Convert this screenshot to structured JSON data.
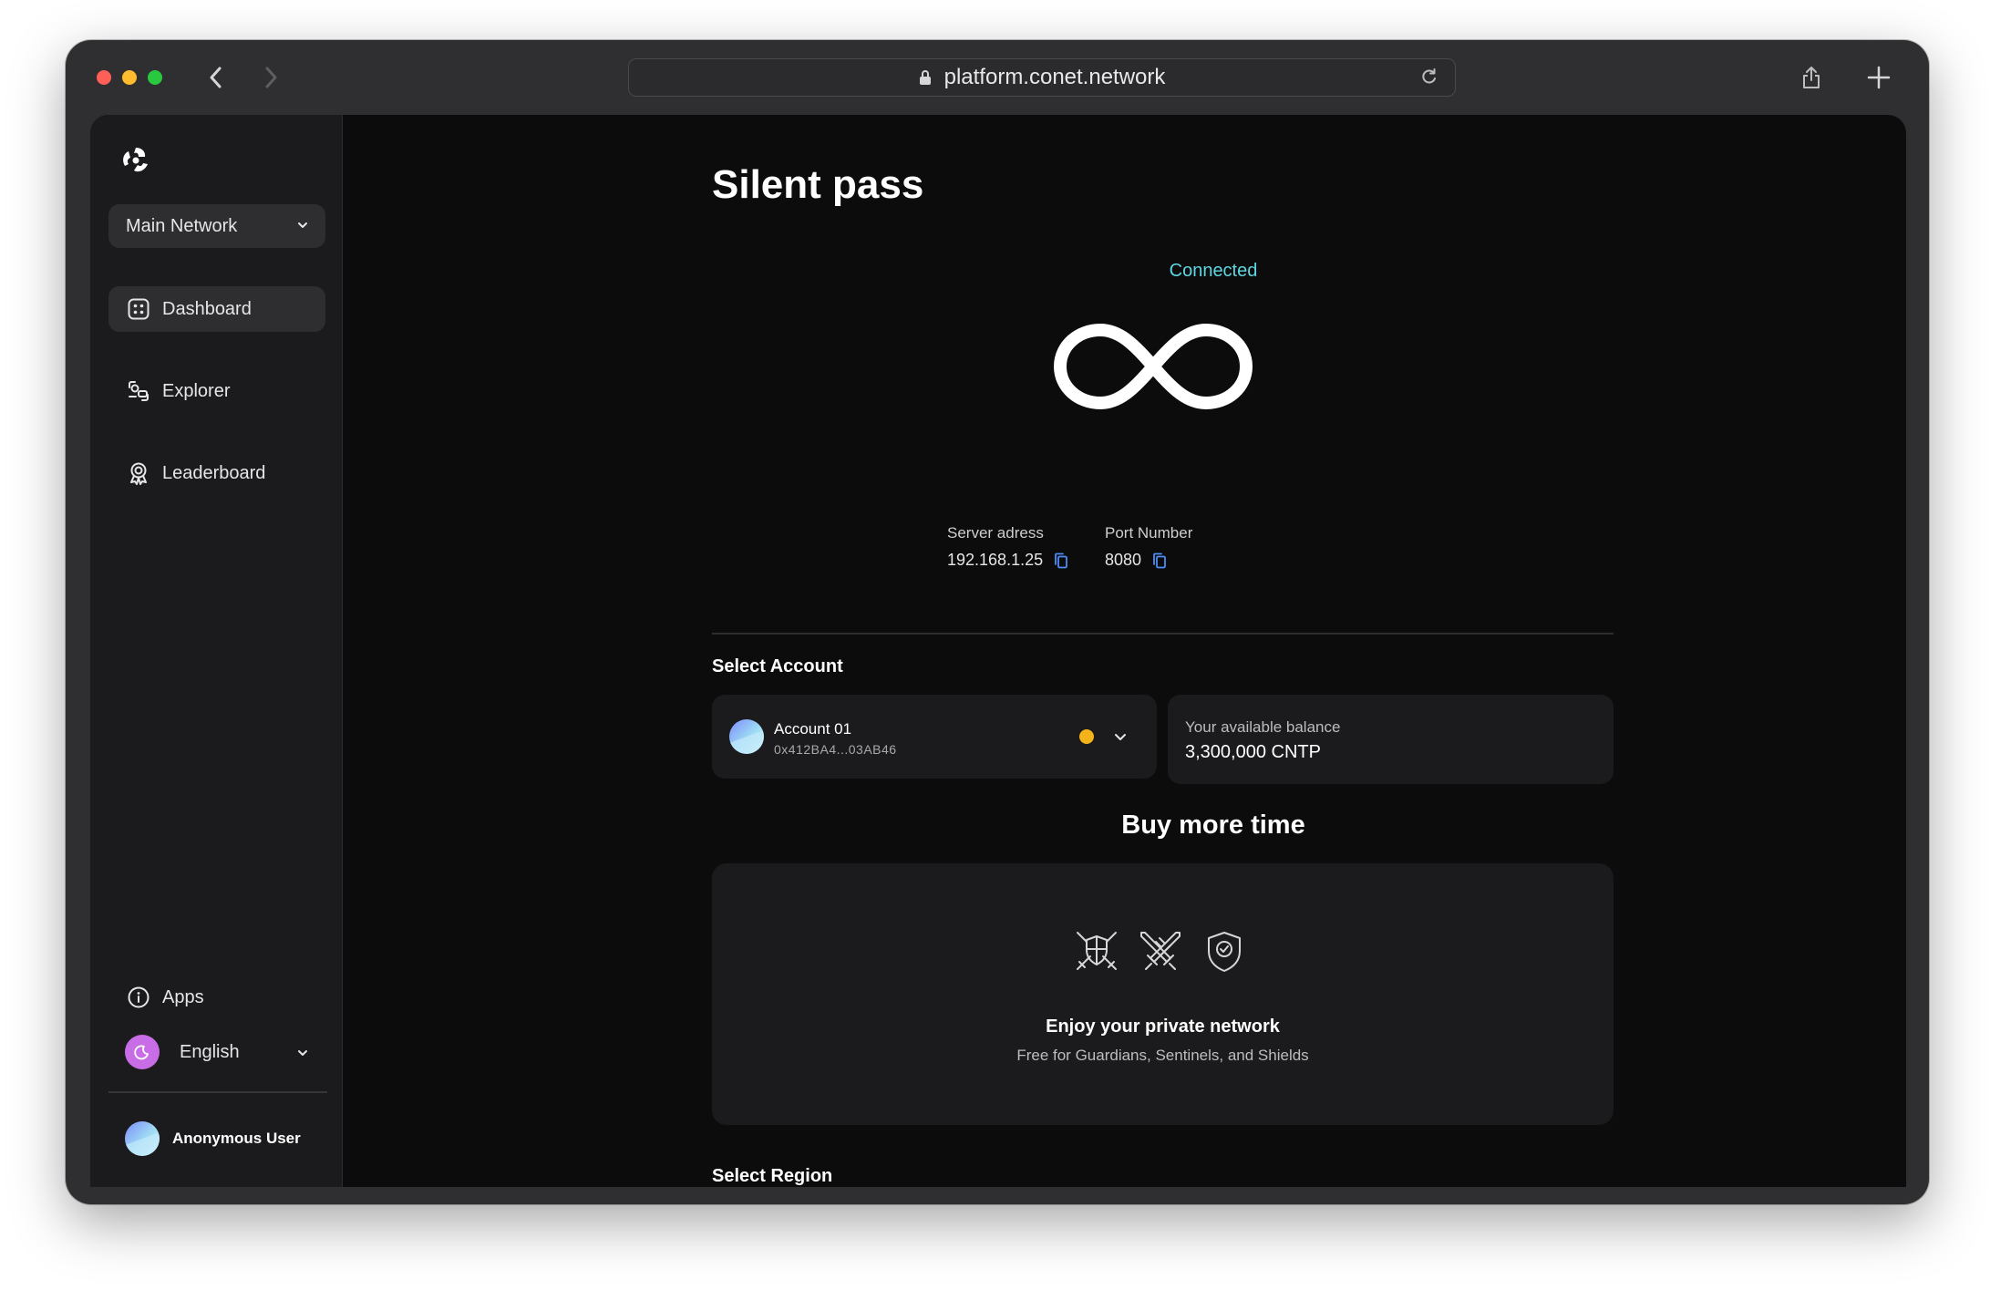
{
  "browser": {
    "url": "platform.conet.network"
  },
  "sidebar": {
    "network_select": "Main Network",
    "items": [
      {
        "label": "Dashboard",
        "icon": "dashboard-icon",
        "active": true
      },
      {
        "label": "Explorer",
        "icon": "explorer-icon",
        "active": false
      },
      {
        "label": "Leaderboard",
        "icon": "leaderboard-icon",
        "active": false
      }
    ],
    "apps_label": "Apps",
    "language": "English",
    "user_name": "Anonymous User"
  },
  "main": {
    "title": "Silent pass",
    "status": "Connected",
    "server_address_label": "Server adress",
    "server_address": "192.168.1.25",
    "port_label": "Port Number",
    "port": "8080",
    "select_account_label": "Select Account",
    "account": {
      "name": "Account 01",
      "address": "0x412BA4...03AB46"
    },
    "balance_label": "Your available balance",
    "balance": "3,300,000 CNTP",
    "buy_title": "Buy more time",
    "promo_title": "Enjoy your private network",
    "promo_sub": "Free for Guardians, Sentinels, and Shields",
    "select_region_label": "Select Region"
  },
  "colors": {
    "accent_connected": "#5fd7e3",
    "status_dot": "#f4b31b",
    "language_badge": "#c96de6"
  }
}
